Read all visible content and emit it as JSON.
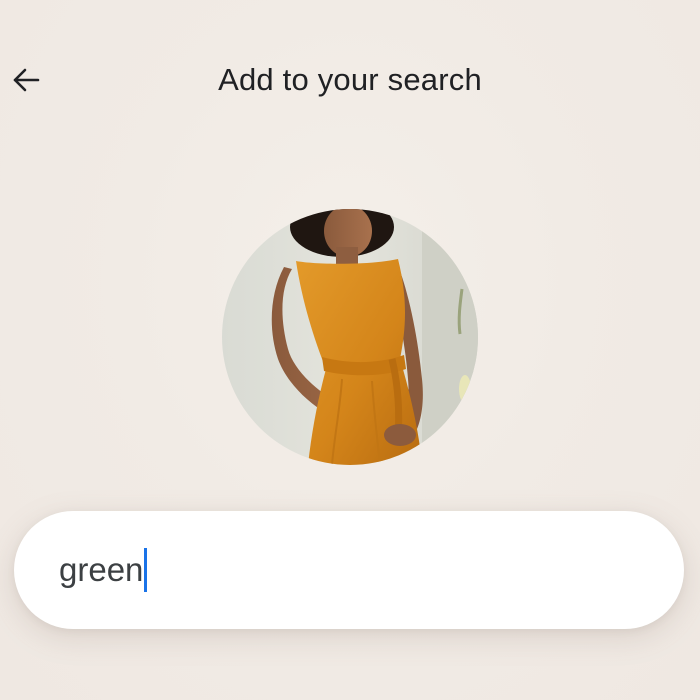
{
  "header": {
    "title": "Add to your search",
    "back_icon": "arrow-left-icon"
  },
  "image": {
    "subject": "product-photo",
    "accent_color": "#d88a1c"
  },
  "search": {
    "value": "green",
    "caret_color": "#1a73e8"
  }
}
